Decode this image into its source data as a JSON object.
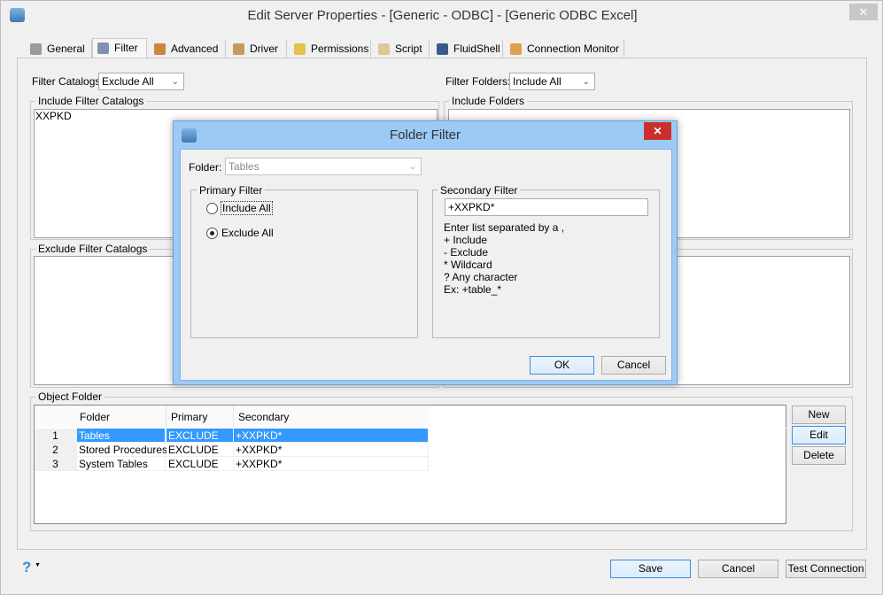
{
  "window": {
    "title": "Edit Server Properties - [Generic - ODBC] - [Generic ODBC Excel]",
    "close": "✕"
  },
  "tabs": [
    {
      "label": "General"
    },
    {
      "label": "Filter"
    },
    {
      "label": "Advanced"
    },
    {
      "label": "Driver"
    },
    {
      "label": "Permissions"
    },
    {
      "label": "Script"
    },
    {
      "label": "FluidShell"
    },
    {
      "label": "Connection Monitor"
    }
  ],
  "filter": {
    "catalogs_label": "Filter Catalogs",
    "catalogs_value": "Exclude All",
    "folders_label": "Filter Folders:",
    "folders_value": "Include All",
    "include_catalogs_title": "Include Filter Catalogs",
    "include_catalogs_items": [
      "XXPKD"
    ],
    "include_folders_title": "Include Folders",
    "exclude_catalogs_title": "Exclude Filter Catalogs",
    "object_folder_title": "Object Folder",
    "table": {
      "headers": [
        "",
        "Folder",
        "Primary",
        "Secondary"
      ],
      "rows": [
        [
          "1",
          "Tables",
          "EXCLUDE",
          "+XXPKD*"
        ],
        [
          "2",
          "Stored Procedures",
          "EXCLUDE",
          "+XXPKD*"
        ],
        [
          "3",
          "System Tables",
          "EXCLUDE",
          "+XXPKD*"
        ]
      ]
    },
    "buttons": {
      "new": "New",
      "edit": "Edit",
      "delete": "Delete"
    }
  },
  "footer": {
    "help": "?",
    "save": "Save",
    "cancel": "Cancel",
    "test": "Test Connection"
  },
  "dialog": {
    "title": "Folder Filter",
    "close": "✕",
    "folder_label": "Folder:",
    "folder_value": "Tables",
    "primary_title": "Primary Filter",
    "include_all": "Include All",
    "exclude_all": "Exclude All",
    "secondary_title": "Secondary Filter",
    "secondary_value": "+XXPKD*",
    "help_lines": [
      "Enter list separated by a ,",
      "+ Include",
      "- Exclude",
      "* Wildcard",
      "? Any character",
      "Ex: +table_*"
    ],
    "ok": "OK",
    "cancel": "Cancel"
  },
  "colors": {
    "selection": "#3399ff",
    "dialog_title": "#9ccaf4",
    "close_red": "#c9302c"
  }
}
